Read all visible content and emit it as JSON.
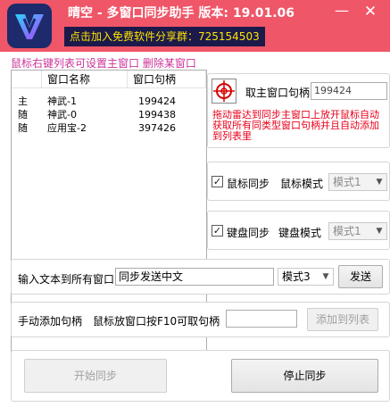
{
  "app": {
    "title": "晴空 - 多窗口同步助手  版本: 19.01.06",
    "promo": "点击加入免费软件分享群：725154503",
    "minimize_glyph": "—",
    "close_glyph": "✕"
  },
  "hint": "鼠标右键列表可设置主窗口  删除某窗口",
  "window_list": {
    "columns": [
      "",
      "窗口名称",
      "窗口句柄"
    ],
    "rows": [
      {
        "role": "主",
        "name": "神武-1",
        "handle": "199424"
      },
      {
        "role": "随",
        "name": "神武-0",
        "handle": "199438"
      },
      {
        "role": "随",
        "name": "应用宝-2",
        "handle": "397426"
      }
    ]
  },
  "main_window": {
    "label": "取主窗口句柄",
    "handle_value": "199424",
    "drag_hint": "拖动雷达到同步主窗口上放开鼠标自动获取所有同类型窗口句柄并且自动添加到列表里",
    "radar_icon": "crosshair-radar-icon"
  },
  "mouse_sync": {
    "checkbox_label": "鼠标同步",
    "checked": true,
    "mode_label": "鼠标模式",
    "mode_value": "模式1"
  },
  "keyboard_sync": {
    "checkbox_label": "键盘同步",
    "checked": true,
    "mode_label": "键盘模式",
    "mode_value": "模式1"
  },
  "text_send": {
    "label": "输入文本到所有窗口",
    "input_value": "同步发送中文",
    "mode_value": "模式3",
    "send_button": "发送"
  },
  "manual_add": {
    "label": "手动添加句柄",
    "hint": "鼠标放窗口按F10可取句柄",
    "input_value": "",
    "add_button": "添加到列表"
  },
  "controls": {
    "start_button": "开始同步",
    "stop_button": "停止同步"
  },
  "colors": {
    "titlebar": "#ef5668",
    "promo_bg": "#1b1a4a",
    "promo_text": "#ffe400",
    "hint_text": "#cc3399",
    "drag_hint_text": "#e8001a"
  }
}
